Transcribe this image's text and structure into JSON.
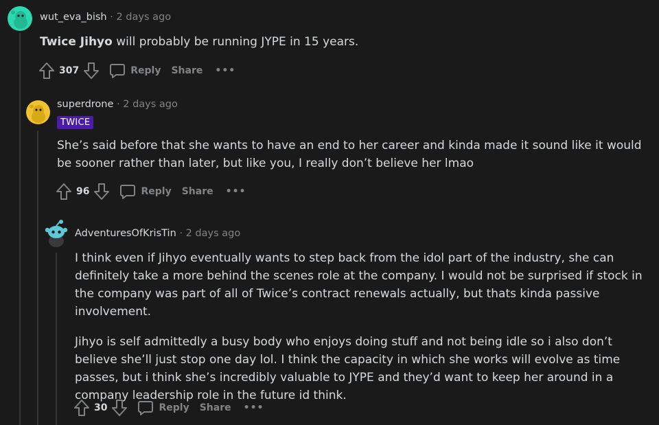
{
  "comments": [
    {
      "username": "wut_eva_bish",
      "separator": "·",
      "time": "2 days ago",
      "body_bold": "Twice Jihyo",
      "body_rest": " will probably be running JYPE in 15 years.",
      "votes": "307",
      "reply_label": "Reply",
      "share_label": "Share",
      "more_label": "•••",
      "avatar_color": "#2ad9b0"
    },
    {
      "username": "superdrone",
      "separator": "·",
      "time": "2 days ago",
      "flair": "TWICE",
      "flair_color": "#4a1ca8",
      "paragraphs": [
        "She’s said before that she wants to have an end to her career and kinda made it sound like it would be sooner rather than later, but like you, I really don’t believe her lmao"
      ],
      "votes": "96",
      "reply_label": "Reply",
      "share_label": "Share",
      "more_label": "•••",
      "avatar_color": "#f2c330"
    },
    {
      "username": "AdventuresOfKrisTin",
      "separator": "·",
      "time": "2 days ago",
      "paragraphs": [
        "I think even if Jihyo eventually wants to step back from the idol part of the industry, she can definitely take a more behind the scenes role at the company. I would not be surprised if stock in the company was part of all of Twice’s contract renewals actually, but thats kinda passive involvement.",
        "Jihyo is self admittedly a busy body who enjoys doing stuff and not being idle so i also don’t believe she’ll just stop one day lol. I think the capacity in which she works will evolve as time passes, but i think she’s incredibly valuable to JYPE and they’d want to keep her around in a company leadership role in the future id think."
      ],
      "votes": "30",
      "reply_label": "Reply",
      "share_label": "Share",
      "more_label": "•••",
      "avatar_color": "#3a3a3c"
    }
  ],
  "icons": {
    "upvote": "upvote-arrow-icon",
    "downvote": "downvote-arrow-icon",
    "reply": "speech-bubble-icon",
    "more": "ellipsis-icon"
  }
}
